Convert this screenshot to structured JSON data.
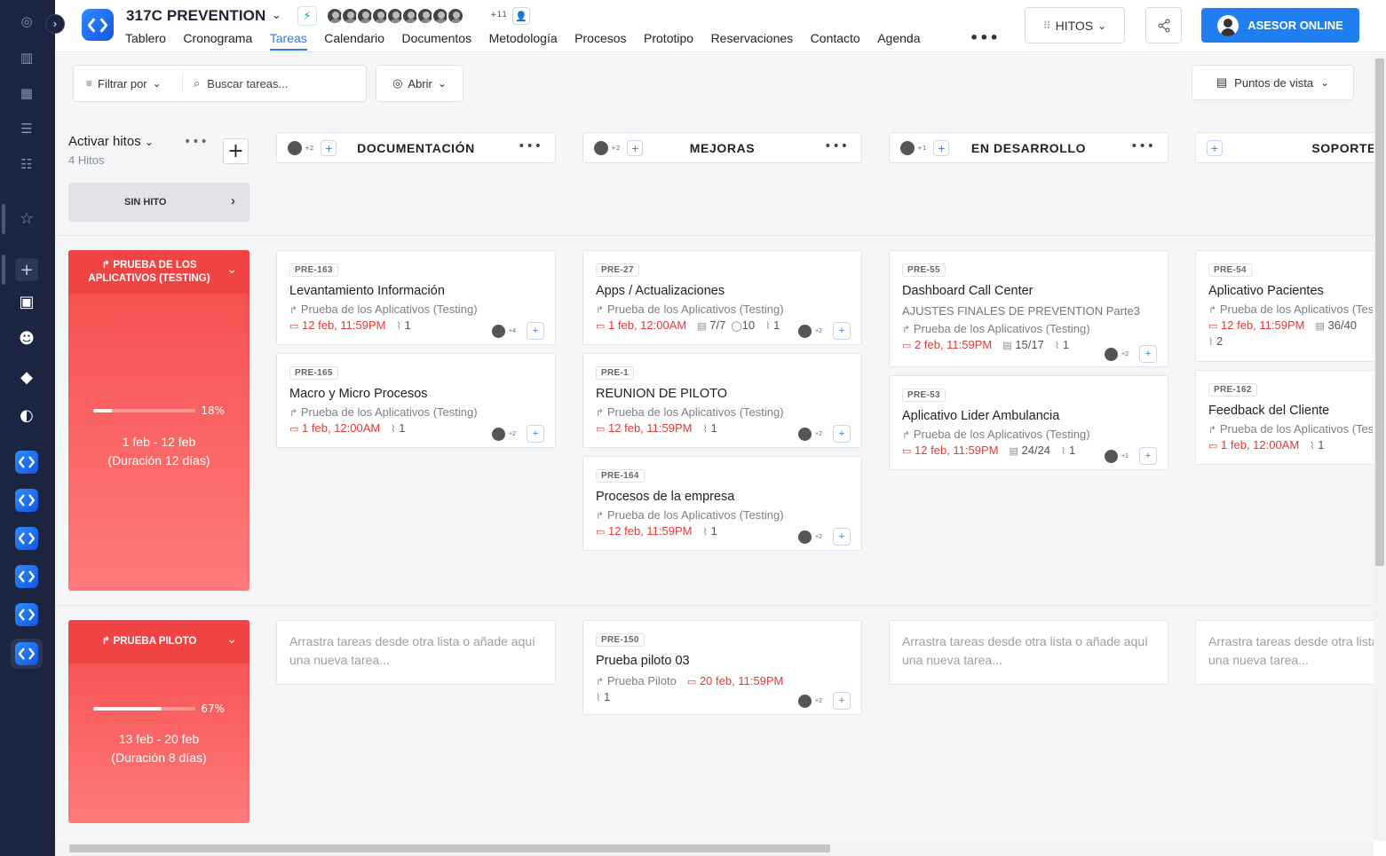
{
  "project": {
    "title": "317C PREVENTION",
    "team_more": "+11"
  },
  "nav": [
    "Tablero",
    "Cronograma",
    "Tareas",
    "Calendario",
    "Documentos",
    "Metodología",
    "Procesos",
    "Prototipo",
    "Reservaciones",
    "Contacto",
    "Agenda"
  ],
  "nav_active": "Tareas",
  "toolbar": {
    "hitos_label": "HITOS",
    "asesor_label": "ASESOR ONLINE"
  },
  "filters": {
    "filter_label": "Filtrar por",
    "search_placeholder": "Buscar tareas...",
    "abrir_label": "Abrir",
    "puntos_label": "Puntos de vista"
  },
  "sidebar_panel": {
    "title": "Activar hitos",
    "count": "4 Hitos",
    "sin_hito": "SIN HITO"
  },
  "columns": [
    {
      "name": "DOCUMENTACIÓN",
      "plus": "+2"
    },
    {
      "name": "MEJORAS",
      "plus": "+2"
    },
    {
      "name": "EN DESARROLLO",
      "plus": "+1"
    },
    {
      "name": "SOPORTE",
      "plus": ""
    }
  ],
  "milestones": [
    {
      "name": "PRUEBA DE LOS APLICATIVOS (TESTING)",
      "progress": 18,
      "pct_label": "18%",
      "dates": "1 feb - 12 feb",
      "duration": "(Duración 12 días)"
    },
    {
      "name": "PRUEBA PILOTO",
      "progress": 67,
      "pct_label": "67%",
      "dates": "13 feb - 20 feb",
      "duration": "(Duración 8 días)"
    }
  ],
  "cards": {
    "c163": {
      "id": "PRE-163",
      "title": "Levantamiento Información",
      "milestone": "Prueba de los Aplicativos (Testing)",
      "due": "12 feb, 11:59PM",
      "attach": "1",
      "plus": "+4"
    },
    "c165": {
      "id": "PRE-165",
      "title": "Macro y Micro Procesos",
      "milestone": "Prueba de los Aplicativos (Testing)",
      "due": "1 feb, 12:00AM",
      "attach": "1",
      "plus": "+2"
    },
    "c27": {
      "id": "PRE-27",
      "title": "Apps / Actualizaciones",
      "milestone": "Prueba de los Aplicativos (Testing)",
      "due": "1 feb, 12:00AM",
      "checklist": "7/7",
      "comments": "10",
      "attach": "1",
      "plus": "+2"
    },
    "c1": {
      "id": "PRE-1",
      "title": "REUNION DE PILOTO",
      "milestone": "Prueba de los Aplicativos (Testing)",
      "due": "12 feb, 11:59PM",
      "attach": "1",
      "plus": "+2"
    },
    "c164": {
      "id": "PRE-164",
      "title": "Procesos de la empresa",
      "milestone": "Prueba de los Aplicativos (Testing)",
      "due": "12 feb, 11:59PM",
      "attach": "1",
      "plus": "+2"
    },
    "c55": {
      "id": "PRE-55",
      "title": "Dashboard Call Center",
      "subtitle": "AJUSTES FINALES DE PREVENTION Parte3",
      "milestone": "Prueba de los Aplicativos (Testing)",
      "due": "2 feb, 11:59PM",
      "checklist": "15/17",
      "attach": "1",
      "plus": "+2"
    },
    "c53": {
      "id": "PRE-53",
      "title": "Aplicativo Lider Ambulancia",
      "milestone": "Prueba de los Aplicativos (Testing)",
      "due": "12 feb, 11:59PM",
      "checklist": "24/24",
      "attach": "1",
      "plus": "+1"
    },
    "c54": {
      "id": "PRE-54",
      "title": "Aplicativo Pacientes",
      "milestone": "Prueba de los Aplicativos (Testing)",
      "due": "12 feb, 11:59PM",
      "checklist": "36/40",
      "attach": "2"
    },
    "c162": {
      "id": "PRE-162",
      "title": "Feedback del Cliente",
      "milestone": "Prueba de los Aplicativos (Testing)",
      "due": "1 feb, 12:00AM",
      "attach": "1"
    },
    "c150": {
      "id": "PRE-150",
      "title": "Prueba piloto 03",
      "milestone": "Prueba Piloto",
      "due": "20 feb, 11:59PM",
      "attach": "1",
      "plus": "+2"
    }
  },
  "drop_text": "Arrastra tareas desde otra lista o añade aquí una nueva tarea...",
  "colors": {
    "accent": "#2c7be5",
    "milestone": "#f54b4b",
    "due": "#e53935",
    "leftbar": "#1b2440"
  }
}
